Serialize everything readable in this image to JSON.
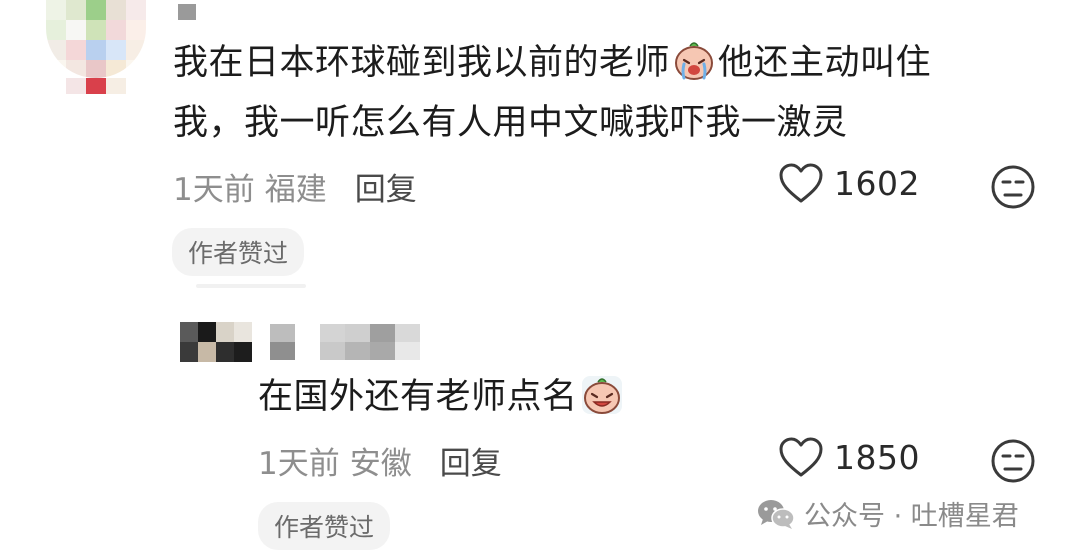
{
  "comments": [
    {
      "text_line1_a": "我在日本环球碰到我以前的老师",
      "text_line1_b": "他还主动叫住",
      "text_line2": "我，我一听怎么有人用中文喊我吓我一激灵",
      "time": "1天前",
      "location": "福建",
      "reply_label": "回复",
      "likes": "1602",
      "badge": "作者赞过",
      "emoji_icon": "crying-face-sticker"
    },
    {
      "text_line1_a": "在国外还有老师点名",
      "time": "1天前",
      "location": "安徽",
      "reply_label": "回复",
      "likes": "1850",
      "badge": "作者赞过",
      "emoji_icon": "crying-face-sticker"
    }
  ],
  "watermark": {
    "text": "公众号 · 吐槽星君",
    "icon": "wechat-icon"
  },
  "colors": {
    "text": "#1c1c1c",
    "meta": "#8e8e8e",
    "badge_bg": "#f3f3f3",
    "icon_stroke": "#3a3a3a"
  }
}
